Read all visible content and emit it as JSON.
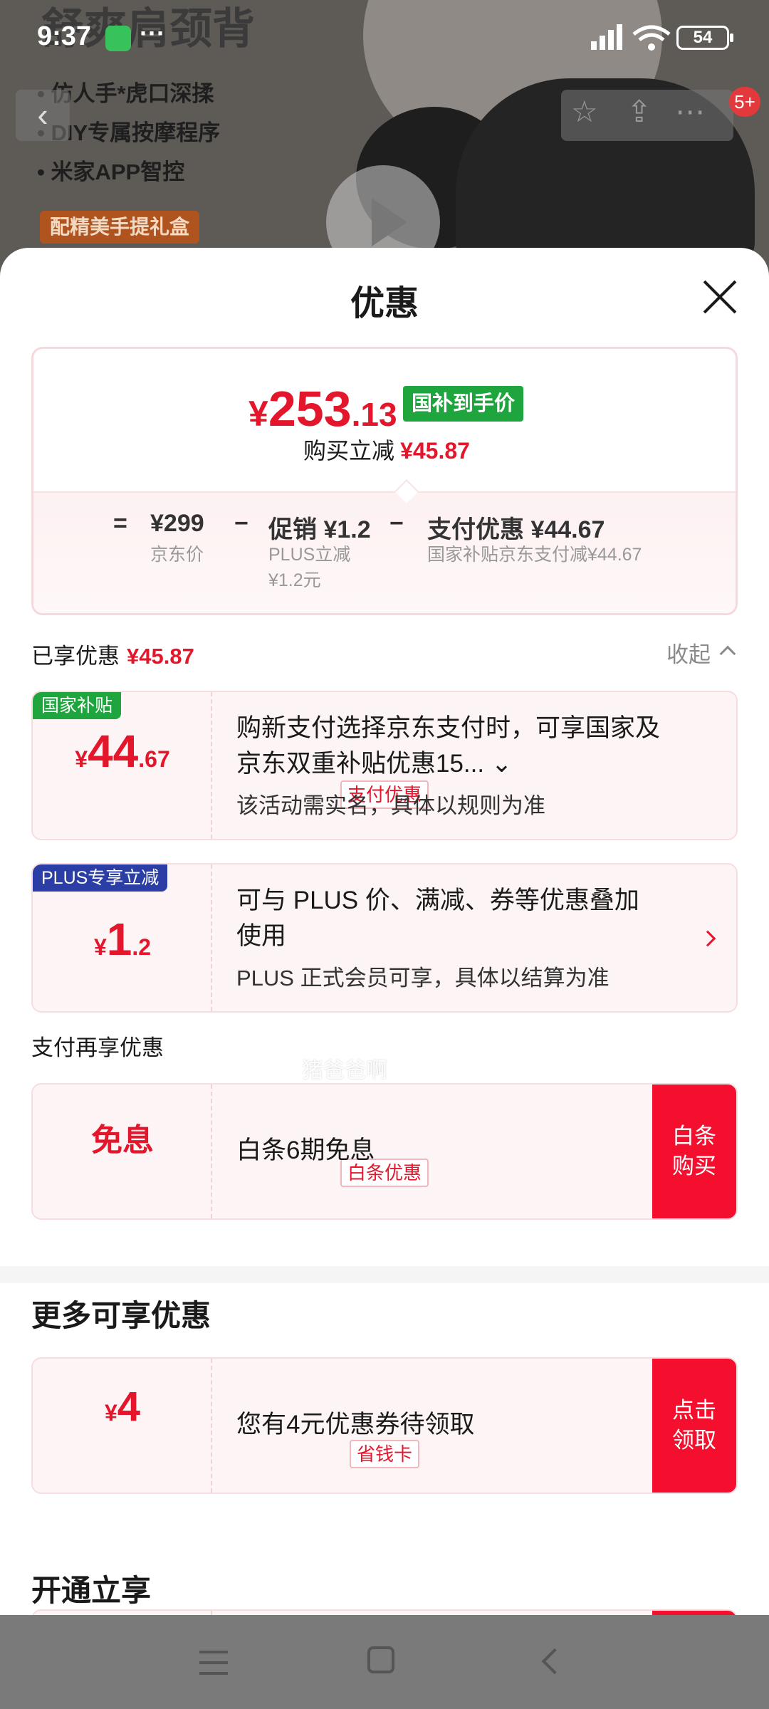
{
  "status_bar": {
    "time": "9:37",
    "dots": "···",
    "battery": "54"
  },
  "hero": {
    "title": "舒爽肩颈背",
    "bullets": [
      "• 仿人手*虎口深揉",
      "• DIY专属按摩程序",
      "• 米家APP智控"
    ],
    "gift_badge": "配精美手提礼盒",
    "back_glyph": "‹",
    "cart_badge": "5+"
  },
  "sheet": {
    "title": "优惠",
    "summary": {
      "price_symbol": "¥",
      "price_int": "253",
      "price_dec": ".13",
      "gov_tag": "国补到手价",
      "reduce_label": "购买立减",
      "reduce_value": "¥45.87",
      "eq": "=",
      "base_price": "¥299",
      "base_label": "京东价",
      "minus1": "−",
      "promo": "促销 ¥1.2",
      "promo_sub1": "PLUS立减",
      "promo_sub2": "¥1.2元",
      "minus2": "−",
      "pay": "支付优惠 ¥44.67",
      "pay_sub": "国家补贴京东支付减¥44.67"
    },
    "enjoyed_label": "已享优惠",
    "enjoyed_value": "¥45.87",
    "collapse_label": "收起",
    "cards": [
      {
        "tag": "国家补贴",
        "symbol": "¥",
        "int": "44",
        "dec": ".67",
        "kind": "支付优惠",
        "desc1": "购新支付选择京东支付时，可享国家及",
        "desc2": "京东双重补贴优惠15... ⌄",
        "sub": "该活动需实名，具体以规则为准"
      },
      {
        "tag": "PLUS专享立减",
        "symbol": "¥",
        "int": "1",
        "dec": ".2",
        "desc1": "可与 PLUS 价、满减、券等优惠叠加",
        "desc2": "使用",
        "sub": "PLUS 正式会员可享，具体以结算为准"
      }
    ],
    "pay_section_title": "支付再享优惠",
    "baitiao": {
      "amount": "免息",
      "kind": "白条优惠",
      "desc": "白条6期免息",
      "cta": "白条\n购买"
    },
    "more_title": "更多可享优惠",
    "coupon": {
      "symbol": "¥",
      "int": "4",
      "kind": "省钱卡",
      "desc": "您有4元优惠券待领取",
      "cta": "点击\n领取"
    },
    "open_title": "开通立享",
    "watermark": "猪爸爸啊"
  },
  "colors": {
    "accent_red": "#e4162c",
    "cta_red": "#f40f2e",
    "gov_green": "#1ea53e",
    "plus_blue": "#2a3ea6"
  }
}
